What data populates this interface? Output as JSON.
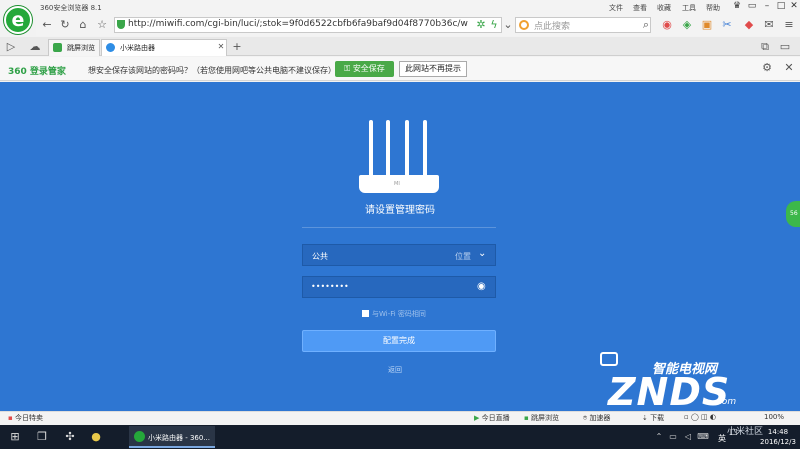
{
  "browser": {
    "title": "360安全浏览器 8.1",
    "logo_letter": "e",
    "menu": [
      "文件",
      "查看",
      "收藏",
      "工具",
      "帮助"
    ]
  },
  "address": {
    "url": "http://miwifi.com/cgi-bin/luci/;stok=9f0d6522cbfb6fa9baf9d04f8770b36c/web/ir",
    "search_placeholder": "点此搜索"
  },
  "tabs": [
    {
      "label": "跳屏浏览"
    },
    {
      "label": "小米路由器"
    }
  ],
  "pwbar": {
    "brand": "360 登录管家",
    "message": "想安全保存该网站的密码吗？（若您使用网吧等公共电脑不建议保存）",
    "save": "安全保存",
    "never": "此网站不再提示"
  },
  "setup": {
    "router_label": "MI",
    "heading": "请设置管理密码",
    "ssid_value": "公共",
    "ssid_location": "位置",
    "password_mask": "••••••••",
    "same_as_wifi": "与Wi-Fi 密码相同",
    "config_button": "配置完成",
    "back": "返回",
    "float": "56"
  },
  "watermark": {
    "top": "智能电视网",
    "main": "ZNDS",
    "com": ".com"
  },
  "statusbar": {
    "left": "今日特卖",
    "items": [
      "今日直播",
      "跳屏浏览",
      "加速器",
      "下载"
    ],
    "zoom": "100%"
  },
  "taskbar": {
    "active_task": "小米路由器 - 360...",
    "ime": "英",
    "time": "14:48",
    "date": "2016/12/3",
    "corner": "小米社区"
  }
}
